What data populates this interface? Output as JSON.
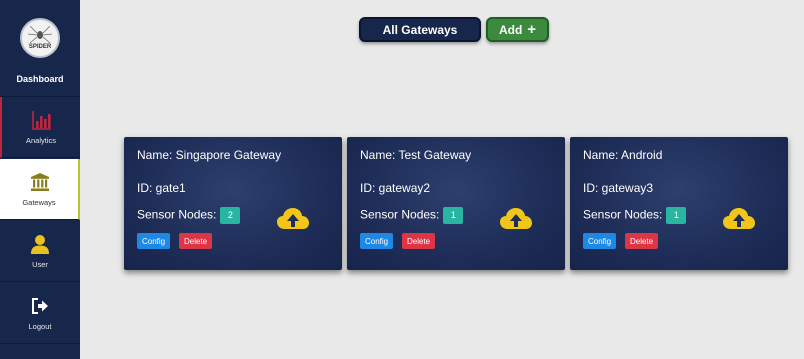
{
  "sidebar": {
    "logo_text": "SPIDER",
    "dashboard_label": "Dashboard",
    "items": [
      {
        "label": "Analytics",
        "icon": "bar-chart-icon"
      },
      {
        "label": "Gateways",
        "icon": "bank-icon"
      },
      {
        "label": "User",
        "icon": "user-icon"
      },
      {
        "label": "Logout",
        "icon": "logout-icon"
      }
    ]
  },
  "header": {
    "all_gateways_label": "All Gateways",
    "add_label": "Add",
    "add_symbol": "+"
  },
  "cards": [
    {
      "name": "Name: Singapore Gateway",
      "id": "ID: gate1",
      "sensor_label": "Sensor Nodes:",
      "sensor_count": "2",
      "config_label": "Config",
      "delete_label": "Delete"
    },
    {
      "name": "Name: Test Gateway",
      "id": "ID: gateway2",
      "sensor_label": "Sensor Nodes:",
      "sensor_count": "1",
      "config_label": "Config",
      "delete_label": "Delete"
    },
    {
      "name": "Name: Android",
      "id": "ID: gateway3",
      "sensor_label": "Sensor Nodes:",
      "sensor_count": "1",
      "config_label": "Config",
      "delete_label": "Delete"
    }
  ],
  "colors": {
    "sidebar": "#17264b",
    "card": "#1e2d57",
    "add_green": "#3b8a3f",
    "badge_teal": "#29b6a0",
    "config_blue": "#1e88e5",
    "delete_red": "#dc3545",
    "analytics_red": "#c0253e",
    "gateways_olive": "#8a7d1b",
    "user_yellow": "#e9c21f"
  }
}
